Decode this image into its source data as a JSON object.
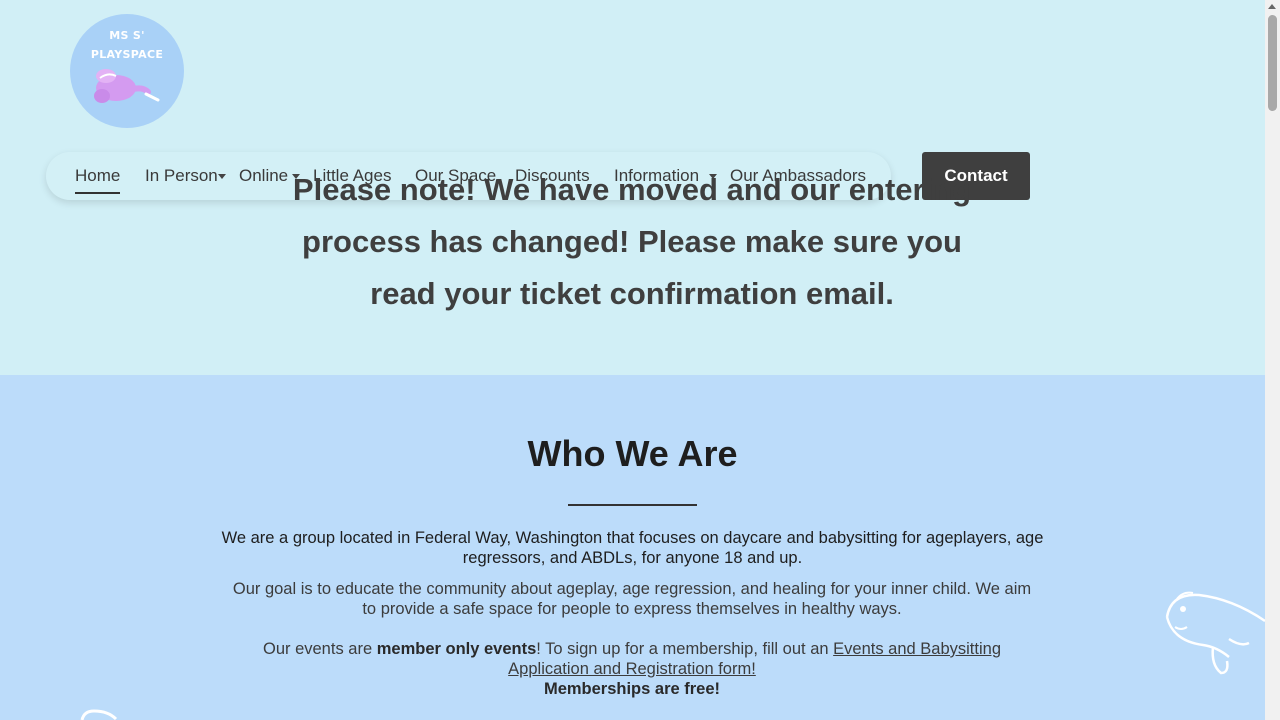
{
  "logo": {
    "line1": "MS S'",
    "line2": "PLAYSPACE"
  },
  "nav": {
    "items": [
      {
        "label": "Home"
      },
      {
        "label": "In Person"
      },
      {
        "label": "Online"
      },
      {
        "label": "Little Ages"
      },
      {
        "label": "Our Space"
      },
      {
        "label": "Discounts"
      },
      {
        "label": "Information"
      },
      {
        "label": "Our Ambassadors"
      }
    ],
    "contact_label": "Contact"
  },
  "notice": "Please note! We have moved and our entering process has changed! Please make sure you read your ticket confirmation email.",
  "who": {
    "title": "Who We Are",
    "p1": "We are a group located in Federal Way, Washington that focuses on daycare and babysitting for ageplayers, age regressors, and ABDLs, for anyone 18 and up.",
    "p2": "Our goal is to educate the community about ageplay, age regression, and healing for your inner child. We aim to provide a safe space for people to express themselves in healthy ways.",
    "p3_start": "Our events are ",
    "p3_bold": "member only events",
    "p3_mid": "! To sign up for a membership, fill out an ",
    "p3_link": "Events and Babysitting Application and Registration form!",
    "p3_end": "Memberships are free!"
  },
  "colors": {
    "top_bg": "#d1eff6",
    "section_bg": "#bcdcfa",
    "button_bg": "#3f3f3f",
    "logo_bg": "#a9d1f7"
  },
  "icons": [
    "logo-mascot-icon",
    "caret-down-icon",
    "fish-doodle-icon"
  ]
}
